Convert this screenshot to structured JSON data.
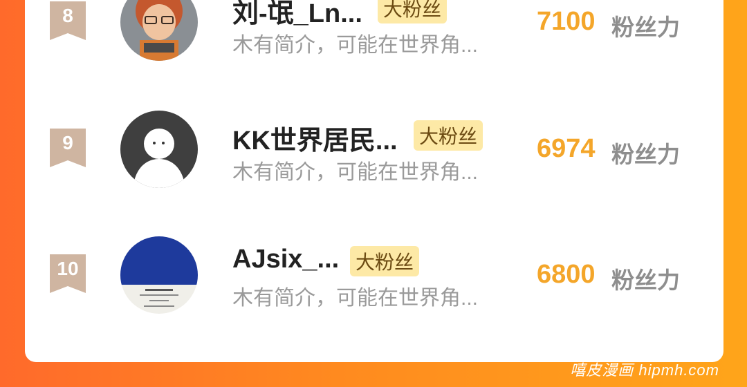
{
  "ranking": {
    "score_unit": "粉丝力",
    "entries": [
      {
        "rank": "8",
        "name": "刘-氓_Ln...",
        "badge": "大粉丝",
        "bio": "木有简介，可能在世界角...",
        "score": "7100",
        "avatar": "cartoon-character-avatar"
      },
      {
        "rank": "9",
        "name": "KK世界居民...",
        "badge": "大粉丝",
        "bio": "木有简介，可能在世界角...",
        "score": "6974",
        "avatar": "default-user-avatar"
      },
      {
        "rank": "10",
        "name": "AJsix_...",
        "badge": "大粉丝",
        "bio": "木有简介，可能在世界角...",
        "score": "6800",
        "avatar": "blue-poster-avatar"
      }
    ]
  },
  "colors": {
    "accent": "#f4a62a",
    "badge_bg": "#fde9a6",
    "rank_badge": "#cfb5a1",
    "background_start": "#ff6a2b",
    "background_end": "#ffa51a"
  },
  "watermark": "嘻皮漫画 hipmh.com"
}
